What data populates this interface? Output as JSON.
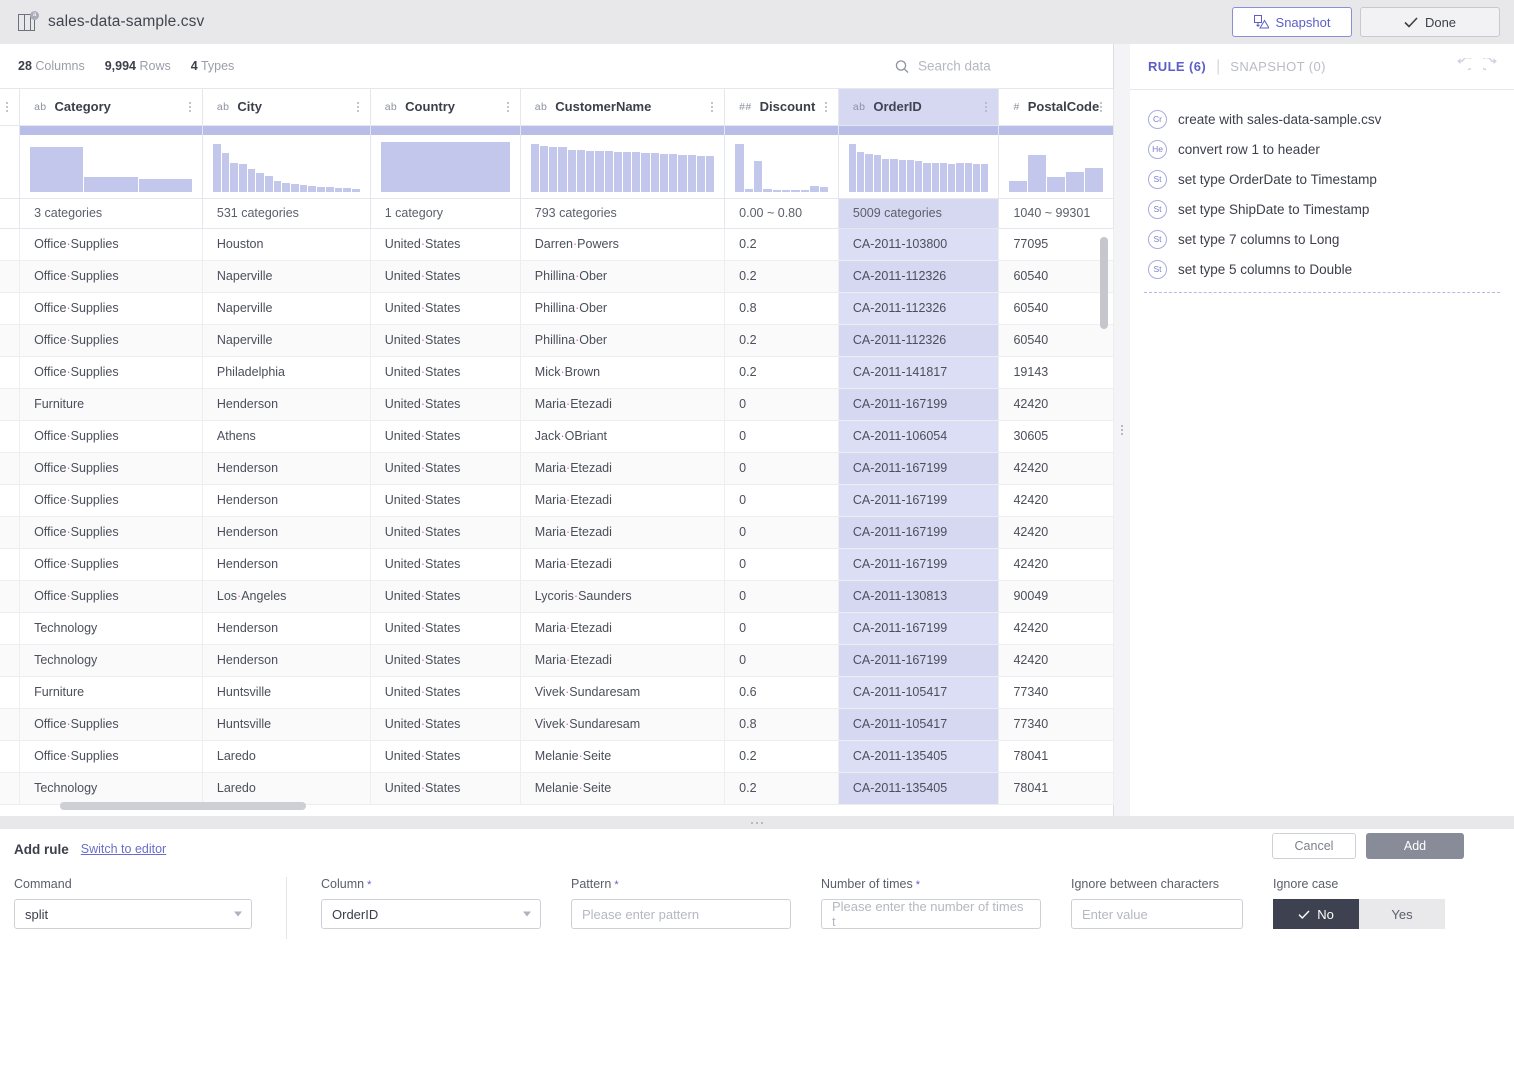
{
  "titlebar": {
    "file_name": "sales-data-sample.csv",
    "file_icon": "table-file-icon",
    "snapshot_label": "Snapshot",
    "done_label": "Done"
  },
  "stats": {
    "columns_value": "28",
    "columns_label": "Columns",
    "rows_value": "9,994",
    "rows_label": "Rows",
    "types_value": "4",
    "types_label": "Types"
  },
  "search": {
    "placeholder": "Search data",
    "icon": "search-icon"
  },
  "table": {
    "columns": [
      {
        "name": "Category",
        "type": "ab",
        "summary": "3 categories",
        "selected": false,
        "bars": [
          90,
          30,
          26
        ]
      },
      {
        "name": "City",
        "type": "ab",
        "summary": "531 categories",
        "selected": false,
        "bars": [
          95,
          78,
          58,
          56,
          46,
          38,
          32,
          22,
          17,
          15,
          14,
          11,
          10,
          9,
          8,
          7,
          6
        ]
      },
      {
        "name": "Country",
        "type": "ab",
        "summary": "1 category",
        "selected": false,
        "bars": [
          100
        ]
      },
      {
        "name": "CustomerName",
        "type": "ab",
        "summary": "793 categories",
        "selected": false,
        "bars": [
          95,
          92,
          90,
          89,
          84,
          83,
          82,
          82,
          81,
          80,
          80,
          79,
          78,
          77,
          76,
          75,
          74,
          73,
          72,
          71
        ]
      },
      {
        "name": "Discount",
        "type": "##",
        "summary": "0.00 ~ 0.80",
        "selected": false,
        "bars": [
          96,
          6,
          62,
          5,
          4,
          4,
          3,
          3,
          12,
          9
        ]
      },
      {
        "name": "OrderID",
        "type": "ab",
        "summary": "5009 categories",
        "selected": true,
        "bars": [
          95,
          80,
          76,
          74,
          66,
          65,
          64,
          63,
          62,
          58,
          57,
          57,
          56,
          58,
          57,
          56,
          56
        ]
      },
      {
        "name": "PostalCode",
        "type": "#",
        "summary": "1040 ~ 99301",
        "selected": false,
        "bars": [
          22,
          74,
          30,
          40,
          48
        ]
      }
    ],
    "rows": [
      {
        "Category": "Office·Supplies",
        "City": "Houston",
        "Country": "United·States",
        "CustomerName": "Darren·Powers",
        "Discount": "0.2",
        "OrderID": "CA-2011-103800",
        "PostalCode": "77095"
      },
      {
        "Category": "Office·Supplies",
        "City": "Naperville",
        "Country": "United·States",
        "CustomerName": "Phillina·Ober",
        "Discount": "0.2",
        "OrderID": "CA-2011-112326",
        "PostalCode": "60540"
      },
      {
        "Category": "Office·Supplies",
        "City": "Naperville",
        "Country": "United·States",
        "CustomerName": "Phillina·Ober",
        "Discount": "0.8",
        "OrderID": "CA-2011-112326",
        "PostalCode": "60540"
      },
      {
        "Category": "Office·Supplies",
        "City": "Naperville",
        "Country": "United·States",
        "CustomerName": "Phillina·Ober",
        "Discount": "0.2",
        "OrderID": "CA-2011-112326",
        "PostalCode": "60540"
      },
      {
        "Category": "Office·Supplies",
        "City": "Philadelphia",
        "Country": "United·States",
        "CustomerName": "Mick·Brown",
        "Discount": "0.2",
        "OrderID": "CA-2011-141817",
        "PostalCode": "19143"
      },
      {
        "Category": "Furniture",
        "City": "Henderson",
        "Country": "United·States",
        "CustomerName": "Maria·Etezadi",
        "Discount": "0",
        "OrderID": "CA-2011-167199",
        "PostalCode": "42420"
      },
      {
        "Category": "Office·Supplies",
        "City": "Athens",
        "Country": "United·States",
        "CustomerName": "Jack·OBriant",
        "Discount": "0",
        "OrderID": "CA-2011-106054",
        "PostalCode": "30605"
      },
      {
        "Category": "Office·Supplies",
        "City": "Henderson",
        "Country": "United·States",
        "CustomerName": "Maria·Etezadi",
        "Discount": "0",
        "OrderID": "CA-2011-167199",
        "PostalCode": "42420"
      },
      {
        "Category": "Office·Supplies",
        "City": "Henderson",
        "Country": "United·States",
        "CustomerName": "Maria·Etezadi",
        "Discount": "0",
        "OrderID": "CA-2011-167199",
        "PostalCode": "42420"
      },
      {
        "Category": "Office·Supplies",
        "City": "Henderson",
        "Country": "United·States",
        "CustomerName": "Maria·Etezadi",
        "Discount": "0",
        "OrderID": "CA-2011-167199",
        "PostalCode": "42420"
      },
      {
        "Category": "Office·Supplies",
        "City": "Henderson",
        "Country": "United·States",
        "CustomerName": "Maria·Etezadi",
        "Discount": "0",
        "OrderID": "CA-2011-167199",
        "PostalCode": "42420"
      },
      {
        "Category": "Office·Supplies",
        "City": "Los·Angeles",
        "Country": "United·States",
        "CustomerName": "Lycoris·Saunders",
        "Discount": "0",
        "OrderID": "CA-2011-130813",
        "PostalCode": "90049"
      },
      {
        "Category": "Technology",
        "City": "Henderson",
        "Country": "United·States",
        "CustomerName": "Maria·Etezadi",
        "Discount": "0",
        "OrderID": "CA-2011-167199",
        "PostalCode": "42420"
      },
      {
        "Category": "Technology",
        "City": "Henderson",
        "Country": "United·States",
        "CustomerName": "Maria·Etezadi",
        "Discount": "0",
        "OrderID": "CA-2011-167199",
        "PostalCode": "42420"
      },
      {
        "Category": "Furniture",
        "City": "Huntsville",
        "Country": "United·States",
        "CustomerName": "Vivek·Sundaresam",
        "Discount": "0.6",
        "OrderID": "CA-2011-105417",
        "PostalCode": "77340"
      },
      {
        "Category": "Office·Supplies",
        "City": "Huntsville",
        "Country": "United·States",
        "CustomerName": "Vivek·Sundaresam",
        "Discount": "0.8",
        "OrderID": "CA-2011-105417",
        "PostalCode": "77340"
      },
      {
        "Category": "Office·Supplies",
        "City": "Laredo",
        "Country": "United·States",
        "CustomerName": "Melanie·Seite",
        "Discount": "0.2",
        "OrderID": "CA-2011-135405",
        "PostalCode": "78041"
      },
      {
        "Category": "Technology",
        "City": "Laredo",
        "Country": "United·States",
        "CustomerName": "Melanie·Seite",
        "Discount": "0.2",
        "OrderID": "CA-2011-135405",
        "PostalCode": "78041"
      }
    ]
  },
  "rule_panel": {
    "tab_rule": "RULE (6)",
    "tab_separator": "|",
    "tab_snapshot": "SNAPSHOT (0)",
    "undo_icon": "undo-icon",
    "redo_icon": "redo-icon",
    "rules": [
      {
        "badge": "Cr",
        "text": "create with sales-data-sample.csv"
      },
      {
        "badge": "He",
        "text": "convert row 1 to header"
      },
      {
        "badge": "St",
        "text": "set type OrderDate to Timestamp"
      },
      {
        "badge": "St",
        "text": "set type ShipDate to Timestamp"
      },
      {
        "badge": "St",
        "text": "set type 7 columns to Long"
      },
      {
        "badge": "St",
        "text": "set type 5 columns to Double"
      }
    ]
  },
  "rule_form": {
    "title": "Add rule",
    "switch_link": "Switch to editor",
    "cancel_label": "Cancel",
    "add_label": "Add",
    "command_label": "Command",
    "command_value": "split",
    "column_label": "Column",
    "column_value": "OrderID",
    "pattern_label": "Pattern",
    "pattern_placeholder": "Please enter pattern",
    "times_label": "Number of times",
    "times_placeholder": "Please enter the number of times t",
    "ignore_between_label": "Ignore between characters",
    "ignore_between_placeholder": "Enter value",
    "ignore_case_label": "Ignore case",
    "ignore_case_no": "No",
    "ignore_case_yes": "Yes",
    "ignore_case_selected": "No"
  },
  "colors": {
    "accent": "#5b5fc7",
    "selection": "#d6d8f2",
    "histogram": "#c3c7ec",
    "whitespace_marker": "#e8589e"
  }
}
